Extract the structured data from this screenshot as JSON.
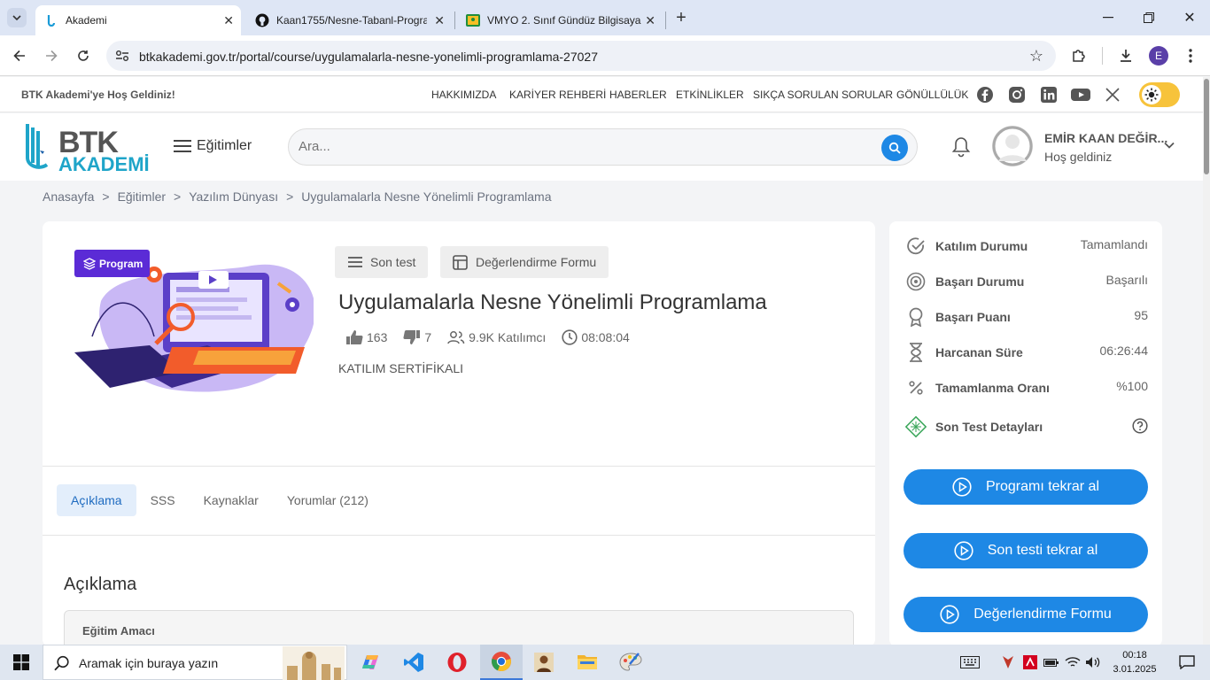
{
  "browser": {
    "tabs": [
      {
        "title": "Akademi",
        "active": true
      },
      {
        "title": "Kaan1755/Nesne-Tabanl-Progra",
        "active": false
      },
      {
        "title": "VMYO 2. Sınıf Gündüz Bilgisaya",
        "active": false
      }
    ],
    "url": "btkakademi.gov.tr/portal/course/uygulamalarla-nesne-yonelimli-programlama-27027",
    "profile_initial": "E"
  },
  "site": {
    "welcome": "BTK Akademi'ye Hoş Geldiniz!",
    "top_nav": [
      "HAKKIMIZDA",
      "KARİYER REHBERİ",
      "HABERLER",
      "ETKİNLİKLER",
      "SIKÇA SORULAN SORULAR",
      "GÖNÜLLÜLÜK"
    ],
    "logo_line1": "BTK",
    "logo_line2": "AKADEMİ",
    "menu_label": "Eğitimler",
    "search_placeholder": "Ara...",
    "user_name": "EMİR KAAN DEĞİR...",
    "user_greeting": "Hoş geldiniz"
  },
  "breadcrumb": [
    "Anasayfa",
    ">",
    "Eğitimler",
    ">",
    "Yazılım Dünyası",
    ">",
    "Uygulamalarla Nesne Yönelimli Programlama"
  ],
  "course": {
    "badge": "Program",
    "chip_test": "Son test",
    "chip_form": "Değerlendirme Formu",
    "title": "Uygulamalarla Nesne Yönelimli Programlama",
    "likes": "163",
    "dislikes": "7",
    "participants": "9.9K Katılımcı",
    "duration": "08:08:04",
    "certificate": "KATILIM SERTİFİKALI",
    "tabs": [
      "Açıklama",
      "SSS",
      "Kaynaklar",
      "Yorumlar (212)"
    ],
    "description_title": "Açıklama",
    "goal_title": "Eğitim Amacı"
  },
  "status": {
    "rows": [
      {
        "label": "Katılım Durumu",
        "value": "Tamamlandı",
        "icon": "check-circle-icon"
      },
      {
        "label": "Başarı Durumu",
        "value": "Başarılı",
        "icon": "target-icon"
      },
      {
        "label": "Başarı Puanı",
        "value": "95",
        "icon": "award-icon"
      },
      {
        "label": "Harcanan Süre",
        "value": "06:26:44",
        "icon": "hourglass-icon"
      },
      {
        "label": "Tamamlanma Oranı",
        "value": "%100",
        "icon": "percent-icon"
      },
      {
        "label": "Son Test Detayları",
        "value": "",
        "icon": "test-details-icon"
      }
    ],
    "buttons": [
      "Programı tekrar al",
      "Son testi tekrar al",
      "Değerlendirme Formu"
    ],
    "accent": "#1e88e5"
  },
  "taskbar": {
    "search_text": "Aramak için buraya yazın",
    "time": "00:18",
    "date": "3.01.2025"
  }
}
